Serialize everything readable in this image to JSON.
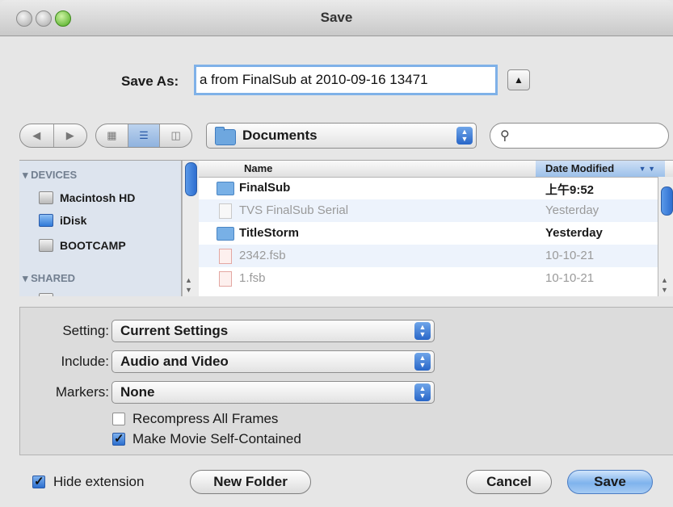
{
  "window": {
    "title": "Save"
  },
  "save_as": {
    "label": "Save As:",
    "value": "a from FinalSub at 2010-09-16 13471"
  },
  "toolbar": {
    "location": "Documents",
    "search_placeholder": ""
  },
  "sidebar": {
    "devices_header": "DEVICES",
    "shared_header": "SHARED",
    "items": [
      {
        "label": "Macintosh HD",
        "icon": "hard-drive-icon"
      },
      {
        "label": "iDisk",
        "icon": "idisk-icon"
      },
      {
        "label": "BOOTCAMP",
        "icon": "hard-drive-icon"
      }
    ]
  },
  "file_list": {
    "col_name": "Name",
    "col_date": "Date Modified",
    "rows": [
      {
        "name": "FinalSub",
        "date": "上午9:52",
        "kind": "folder",
        "enabled": true
      },
      {
        "name": "TVS FinalSub Serial",
        "date": "Yesterday",
        "kind": "document",
        "enabled": false
      },
      {
        "name": "TitleStorm",
        "date": "Yesterday",
        "kind": "folder",
        "enabled": true
      },
      {
        "name": "2342.fsb",
        "date": "10-10-21",
        "kind": "fsb",
        "enabled": false
      },
      {
        "name": "1.fsb",
        "date": "10-10-21",
        "kind": "fsb",
        "enabled": false
      }
    ]
  },
  "options": {
    "setting_label": "Setting:",
    "setting_value": "Current Settings",
    "include_label": "Include:",
    "include_value": "Audio and Video",
    "markers_label": "Markers:",
    "markers_value": "None",
    "recompress_label": "Recompress All Frames",
    "recompress_checked": false,
    "selfcontained_label": "Make Movie Self-Contained",
    "selfcontained_checked": true
  },
  "footer": {
    "hide_extension_label": "Hide extension",
    "hide_extension_checked": true,
    "new_folder": "New Folder",
    "cancel": "Cancel",
    "save": "Save"
  },
  "colors": {
    "accent": "#3a78d4",
    "selection_header": "#b3cef0",
    "sidebar_bg": "#dde4ee"
  }
}
